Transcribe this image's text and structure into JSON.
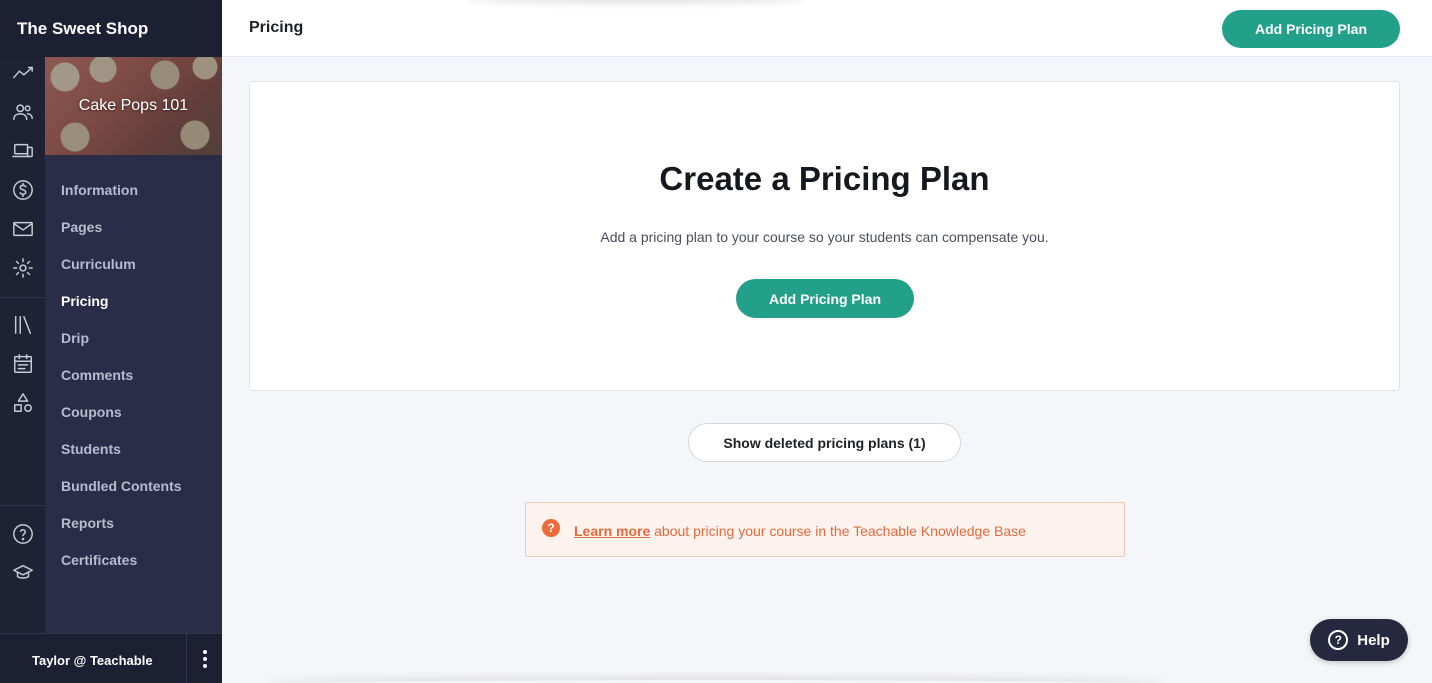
{
  "school": {
    "name": "The Sweet Shop"
  },
  "course": {
    "title": "Cake Pops 101"
  },
  "sidebar": {
    "rail_icons": [
      "trend-icon",
      "users-icon",
      "devices-icon",
      "dollar-icon",
      "mail-icon",
      "settings-icon",
      "library-icon",
      "calendar-icon",
      "shapes-icon",
      "help-icon",
      "graduation-cap-icon"
    ],
    "items": [
      {
        "label": "Information"
      },
      {
        "label": "Pages"
      },
      {
        "label": "Curriculum"
      },
      {
        "label": "Pricing",
        "active": true
      },
      {
        "label": "Drip"
      },
      {
        "label": "Comments"
      },
      {
        "label": "Coupons"
      },
      {
        "label": "Students"
      },
      {
        "label": "Bundled Contents"
      },
      {
        "label": "Reports"
      },
      {
        "label": "Certificates"
      }
    ]
  },
  "user": {
    "name": "Taylor @ Teachable"
  },
  "header": {
    "title": "Pricing",
    "add_button": "Add Pricing Plan"
  },
  "empty_state": {
    "heading": "Create a Pricing Plan",
    "description": "Add a pricing plan to your course so your students can compensate you.",
    "button": "Add Pricing Plan"
  },
  "deleted_button": "Show deleted pricing plans (1)",
  "notice": {
    "icon": "?",
    "link": "Learn more",
    "text": " about pricing your course in the Teachable Knowledge Base"
  },
  "help": {
    "label": "Help",
    "icon": "?"
  },
  "colors": {
    "accent": "#23a08a",
    "sidebar": "#22243a",
    "notice": "#e36a3e"
  }
}
